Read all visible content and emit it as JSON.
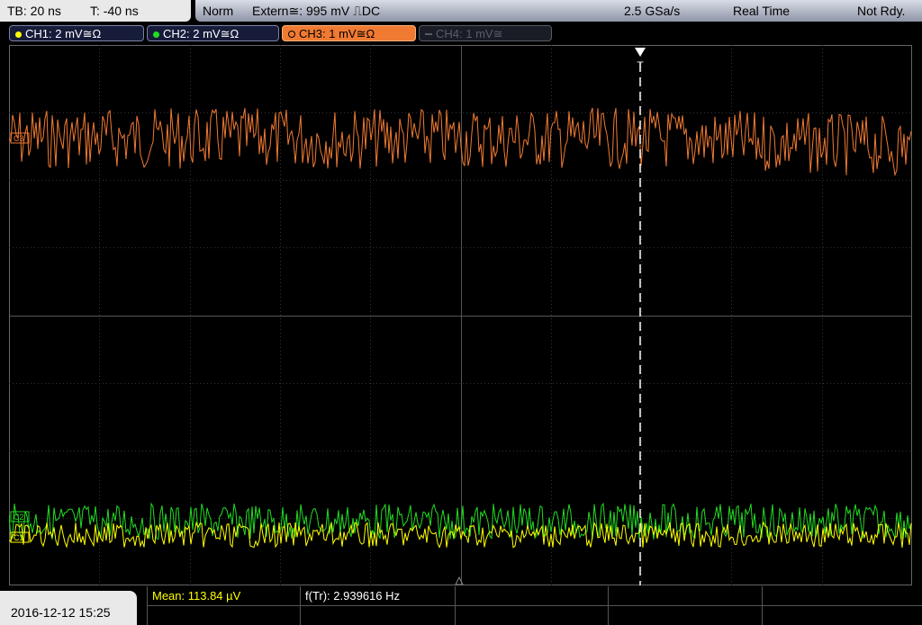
{
  "status": {
    "timebase": "TB: 20 ns",
    "trigger_time": "T: -40 ns",
    "mode": "Norm",
    "trigger_source": "Extern≅: 995 mV ⎍DC",
    "sample_rate": "2.5 GSa/s",
    "acq_mode": "Real Time",
    "state": "Not Rdy."
  },
  "channels": [
    {
      "label": "CH1: 2 mV≅Ω",
      "color": "#ffff00",
      "state": "on"
    },
    {
      "label": "CH2: 2 mV≅Ω",
      "color": "#22dd22",
      "state": "on"
    },
    {
      "label": "CH3: 1 mV≅Ω",
      "color": "#f07a32",
      "state": "selected"
    },
    {
      "label": "CH4: 1 mV≅",
      "color": "#555a66",
      "state": "off"
    }
  ],
  "markers": {
    "ch3": "C3",
    "ch2": "C2",
    "ch1": "C1",
    "trigger": "T"
  },
  "datetime": "2016-12-12 15:25",
  "measurements": {
    "mean": "Mean: 113.84 µV",
    "freq": "f(Tr): 2.939616 Hz"
  }
}
